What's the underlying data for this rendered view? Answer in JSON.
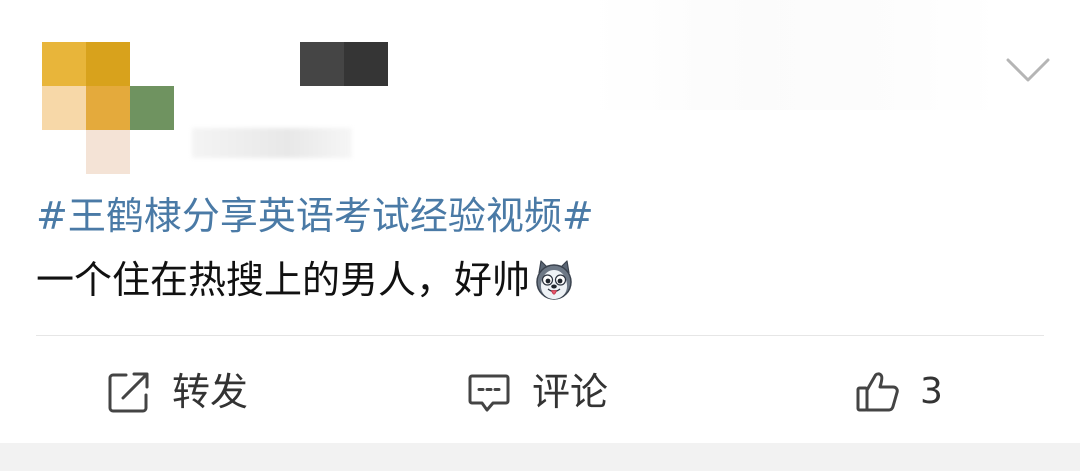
{
  "post": {
    "topic": "#王鹤棣分享英语考试经验视频#",
    "content_text": "一个住在热搜上的男人，好帅",
    "emoji_icon": "husky-dog-emoji-icon",
    "menu_icon": "chevron-down-icon"
  },
  "actions": {
    "repost_label": "转发",
    "repost_icon": "share-edit-icon",
    "comment_label": "评论",
    "comment_icon": "comment-bubble-icon",
    "like_count": "3",
    "like_icon": "thumbs-up-icon"
  },
  "colors": {
    "topic_link": "#4a7aa6",
    "text_primary": "#111111",
    "action_text": "#333333",
    "divider": "#e6e6e6"
  }
}
